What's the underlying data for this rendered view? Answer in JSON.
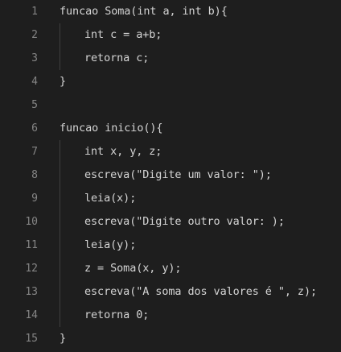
{
  "editor": {
    "lines": [
      {
        "number": "1",
        "text": "funcao Soma(int a, int b){"
      },
      {
        "number": "2",
        "text": "int c = a+b;"
      },
      {
        "number": "3",
        "text": "retorna c;"
      },
      {
        "number": "4",
        "text": "}"
      },
      {
        "number": "5",
        "text": ""
      },
      {
        "number": "6",
        "text": "funcao inicio(){"
      },
      {
        "number": "7",
        "text": "int x, y, z;"
      },
      {
        "number": "8",
        "text": "escreva(\"Digite um valor: \");"
      },
      {
        "number": "9",
        "text": "leia(x);"
      },
      {
        "number": "10",
        "text": "escreva(\"Digite outro valor: );"
      },
      {
        "number": "11",
        "text": "leia(y);"
      },
      {
        "number": "12",
        "text": "z = Soma(x, y);"
      },
      {
        "number": "13",
        "text": "escreva(\"A soma dos valores é \", z);"
      },
      {
        "number": "14",
        "text": "retorna 0;"
      },
      {
        "number": "15",
        "text": "}"
      }
    ]
  },
  "colors": {
    "background": "#1e1e1e",
    "line_number": "#858585",
    "text": "#d4d4d4",
    "indent_guide": "#404040"
  }
}
